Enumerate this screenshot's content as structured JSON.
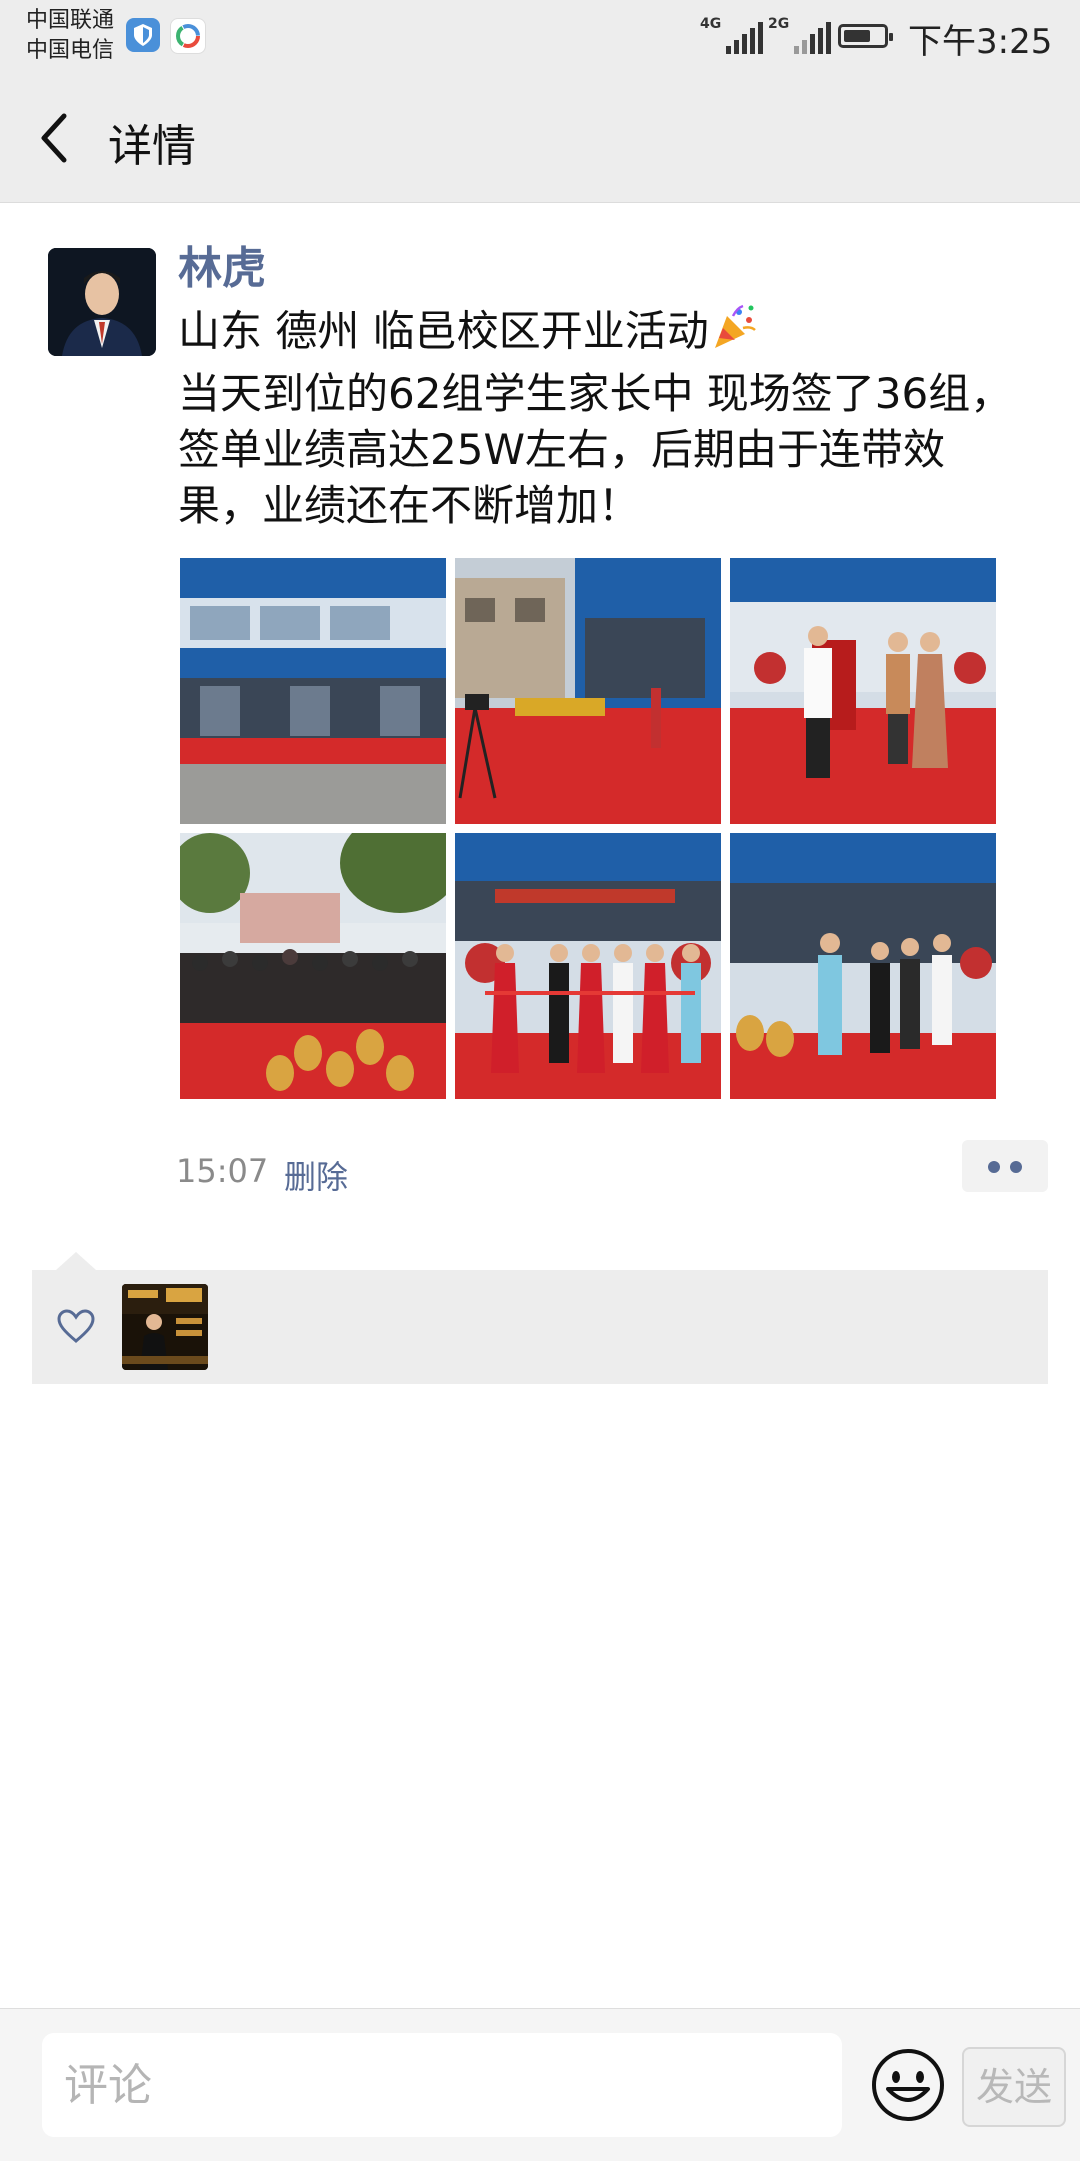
{
  "status_bar": {
    "carrier_1": "中国联通",
    "carrier_2": "中国电信",
    "network_1": "4G",
    "network_2": "2G",
    "time": "下午3:25"
  },
  "nav": {
    "back_icon": "chevron-left-icon",
    "title": "详情"
  },
  "post": {
    "author": "林虎",
    "text": "山东 德州 临邑校区开业活动\n当天到位的62组学生家长中 现场签了36组，签单业绩高达25W左右，后期由于连带效果，业绩还在不断增加！",
    "text_line1": "山东 德州 临邑校区开业活动",
    "text_rest": "当天到位的62组学生家长中 现场签了36组，签单业绩高达25W左右，后期由于连带效果，业绩还在不断增加！",
    "emoji": "party-popper-icon",
    "photo_count": 6,
    "time": "15:07",
    "delete_label": "删除",
    "more_icon": "more-dots-icon"
  },
  "likes": {
    "icon": "heart-icon",
    "count": 1
  },
  "comment_bar": {
    "placeholder": "评论",
    "emoji_icon": "smiley-icon",
    "send_label": "发送"
  },
  "colors": {
    "link_blue": "#576b95",
    "header_bg": "#ededed",
    "carpet_red": "#d42a2a",
    "storefront_blue": "#1f5fa8"
  }
}
